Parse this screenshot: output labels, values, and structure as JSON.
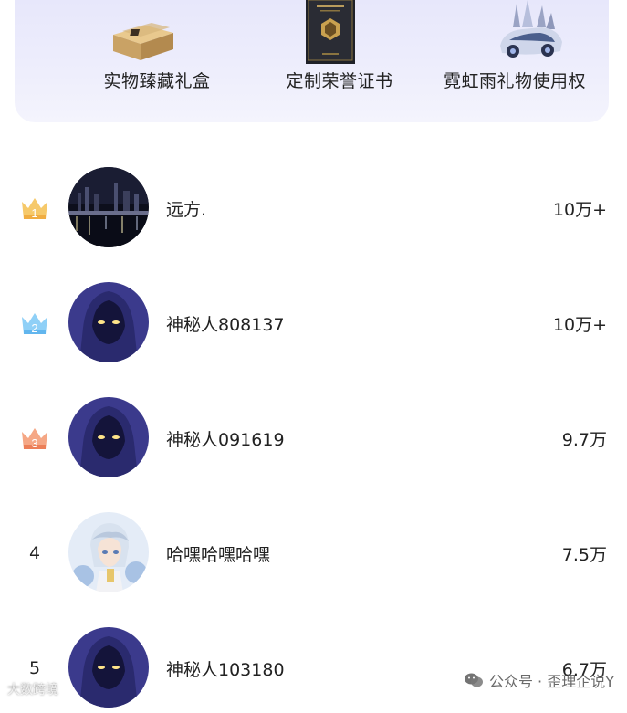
{
  "rewards": [
    {
      "label": "实物臻藏礼盒",
      "icon": "gift-box-icon"
    },
    {
      "label": "定制荣誉证书",
      "icon": "certificate-icon"
    },
    {
      "label": "霓虹雨礼物使用权",
      "icon": "neon-car-icon"
    }
  ],
  "leaderboard": [
    {
      "rank": "1",
      "name": "远方.",
      "score": "10万+",
      "avatar": "city-night-avatar",
      "crown_color": "#f4b851"
    },
    {
      "rank": "2",
      "name": "神秘人808137",
      "score": "10万+",
      "avatar": "hooded-figure-avatar",
      "crown_color": "#7cc3f4"
    },
    {
      "rank": "3",
      "name": "神秘人091619",
      "score": "9.7万",
      "avatar": "hooded-figure-avatar",
      "crown_color": "#f09a76"
    },
    {
      "rank": "4",
      "name": "哈嘿哈嘿哈嘿",
      "score": "7.5万",
      "avatar": "anime-character-avatar"
    },
    {
      "rank": "5",
      "name": "神秘人103180",
      "score": "6.7万",
      "avatar": "hooded-figure-avatar"
    }
  ],
  "watermarks": {
    "left": "大数跨境",
    "right": "公众号 · 歪理企说Y"
  }
}
